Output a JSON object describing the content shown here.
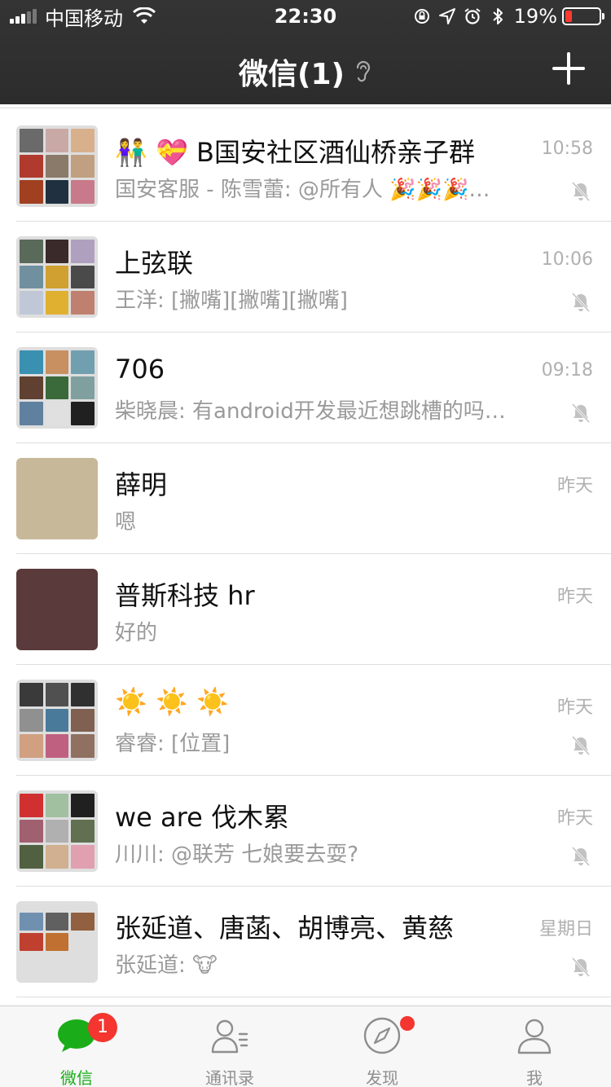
{
  "status_bar": {
    "carrier": "中国移动",
    "time": "22:30",
    "battery": "19%",
    "battery_level": 0.19
  },
  "header": {
    "title": "微信(1)"
  },
  "chats": [
    {
      "name": "👫 💝 B国安社区酒仙桥亲子群",
      "message": "国安客服 - 陈雪蕾: @所有人 🎉🎉🎉…",
      "time": "10:58",
      "muted": true,
      "avatar_colors": [
        "#6a6a6a",
        "#c9a9a6",
        "#d8b08c",
        "#b03a2e",
        "#8a7a6a",
        "#c0a080",
        "#a04020",
        "#203040",
        "#c87a8a"
      ]
    },
    {
      "name": "上弦联",
      "message": "王洋: [撇嘴][撇嘴][撇嘴]",
      "time": "10:06",
      "muted": true,
      "avatar_colors": [
        "#5a6a5a",
        "#3a2a2a",
        "#b0a0c0",
        "#7090a0",
        "#d0a030",
        "#4a4a4a",
        "#c0c8d8",
        "#e0b030",
        "#c08070"
      ]
    },
    {
      "name": "706",
      "message": "柴晓晨: 有android开发最近想跳槽的吗…",
      "time": "09:18",
      "muted": true,
      "avatar_colors": [
        "#3a90b0",
        "#c89060",
        "#70a0b0",
        "#604030",
        "#3a6a3a",
        "#80a0a0",
        "#6080a0",
        "#e0e0e0",
        "#202020"
      ]
    },
    {
      "name": "薛明",
      "message": "嗯",
      "time": "昨天",
      "muted": false,
      "avatar_colors": [
        "#c8b89a"
      ]
    },
    {
      "name": "普斯科技 hr",
      "message": "好的",
      "time": "昨天",
      "muted": false,
      "avatar_colors": [
        "#5a3a3a"
      ]
    },
    {
      "name": "☀️ ☀️ ☀️",
      "message": "睿睿: [位置]",
      "time": "昨天",
      "muted": true,
      "avatar_colors": [
        "#3a3a3a",
        "#505050",
        "#303030",
        "#909090",
        "#4a7a9a",
        "#806050",
        "#d0a080",
        "#c06080",
        "#907060"
      ]
    },
    {
      "name": "we are 伐木累",
      "message": "川川: @联芳 七娘要去耍?",
      "time": "昨天",
      "muted": true,
      "avatar_colors": [
        "#d03030",
        "#a0c0a0",
        "#202020",
        "#a06070",
        "#b0b0b0",
        "#607050",
        "#506040",
        "#d0b090",
        "#e0a0b0"
      ]
    },
    {
      "name": "张延道、唐菡、胡博亮、黄慈",
      "message": "张延道: 🐮",
      "time": "星期日",
      "muted": true,
      "avatar_colors": [
        "#7090b0",
        "#606060",
        "#906040",
        "#c04030",
        "#c07030"
      ]
    }
  ],
  "tabs": [
    {
      "label": "微信",
      "badge": "1",
      "active": true
    },
    {
      "label": "通讯录",
      "active": false
    },
    {
      "label": "发现",
      "dot": true,
      "active": false
    },
    {
      "label": "我",
      "active": false
    }
  ],
  "colors": {
    "accent": "#1aad19",
    "badge": "#f43530",
    "header": "#303030"
  }
}
